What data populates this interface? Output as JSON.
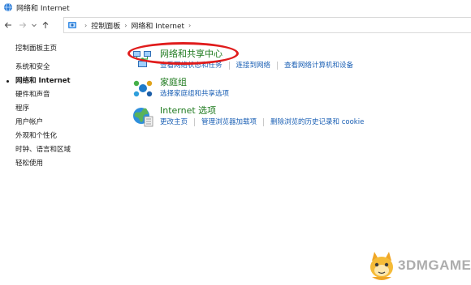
{
  "window": {
    "title": "网络和 Internet"
  },
  "address_bar": {
    "breadcrumbs": [
      "控制面板",
      "网络和 Internet"
    ]
  },
  "sidebar": {
    "items": [
      {
        "label": "控制面板主页",
        "active": false
      },
      {
        "label": "系统和安全",
        "active": false
      },
      {
        "label": "网络和 Internet",
        "active": true
      },
      {
        "label": "硬件和声音",
        "active": false
      },
      {
        "label": "程序",
        "active": false
      },
      {
        "label": "用户帐户",
        "active": false
      },
      {
        "label": "外观和个性化",
        "active": false
      },
      {
        "label": "时钟、语言和区域",
        "active": false
      },
      {
        "label": "轻松使用",
        "active": false
      }
    ]
  },
  "main": {
    "sections": [
      {
        "heading": "网络和共享中心",
        "icon": "network-sharing-center-icon",
        "links": [
          "查看网络状态和任务",
          "连接到网络",
          "查看网络计算机和设备"
        ]
      },
      {
        "heading": "家庭组",
        "icon": "homegroup-icon",
        "links": [
          "选择家庭组和共享选项"
        ]
      },
      {
        "heading": "Internet 选项",
        "icon": "internet-options-icon",
        "links": [
          "更改主页",
          "管理浏览器加载项",
          "删除浏览的历史记录和 cookie"
        ]
      }
    ]
  },
  "colors": {
    "heading_green": "#1e7a1e",
    "link_blue": "#1a5fb4",
    "highlight_red": "#e01c1c"
  },
  "watermark": {
    "text": "3DMGAME"
  }
}
